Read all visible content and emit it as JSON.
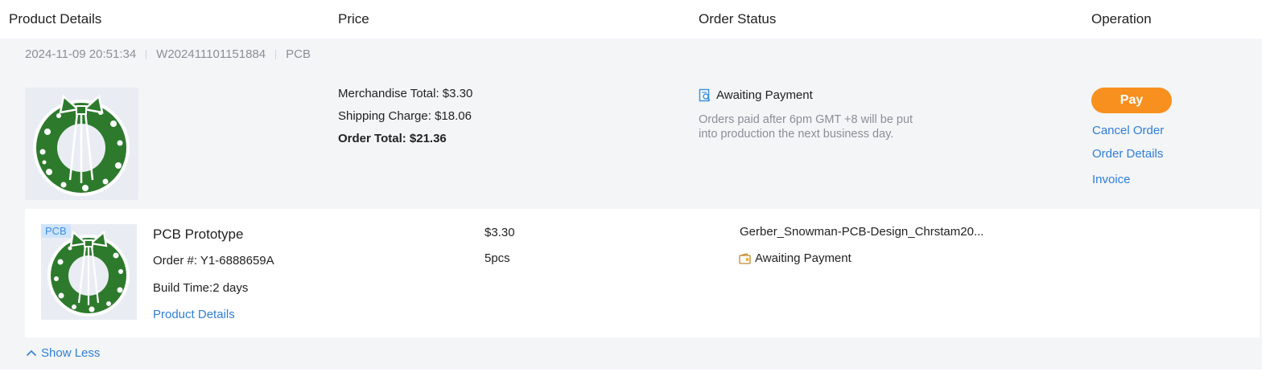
{
  "columns": {
    "product_details": "Product Details",
    "price": "Price",
    "order_status": "Order Status",
    "operation": "Operation"
  },
  "order": {
    "datetime": "2024-11-09 20:51:34",
    "order_id": "W202411101151884",
    "type": "PCB",
    "merchandise_total": "Merchandise Total: $3.30",
    "shipping_charge": "Shipping Charge: $18.06",
    "order_total": "Order Total: $21.36",
    "status": "Awaiting Payment",
    "status_icon": "search-document-icon",
    "status_note": "Orders paid after 6pm GMT +8 will be put into production the next business day.",
    "operations": {
      "pay": "Pay",
      "cancel": "Cancel Order",
      "details": "Order Details",
      "invoice": "Invoice"
    }
  },
  "item": {
    "tag": "PCB",
    "title": "PCB Prototype",
    "order_number": "Order #: Y1-6888659A",
    "build_time": "Build Time:2 days",
    "product_details_link": "Product Details",
    "price": "$3.30",
    "quantity": "5pcs",
    "file_name": "Gerber_Snowman-PCB-Design_Chrstam20...",
    "status": "Awaiting Payment",
    "status_icon": "wallet-icon"
  },
  "show_less": "Show Less",
  "colors": {
    "accent": "#f7901e",
    "link": "#2f7fd8",
    "pcb_green": "#2d7a2d",
    "card_bg": "#f4f5f7",
    "muted_text": "#8a8f98"
  }
}
